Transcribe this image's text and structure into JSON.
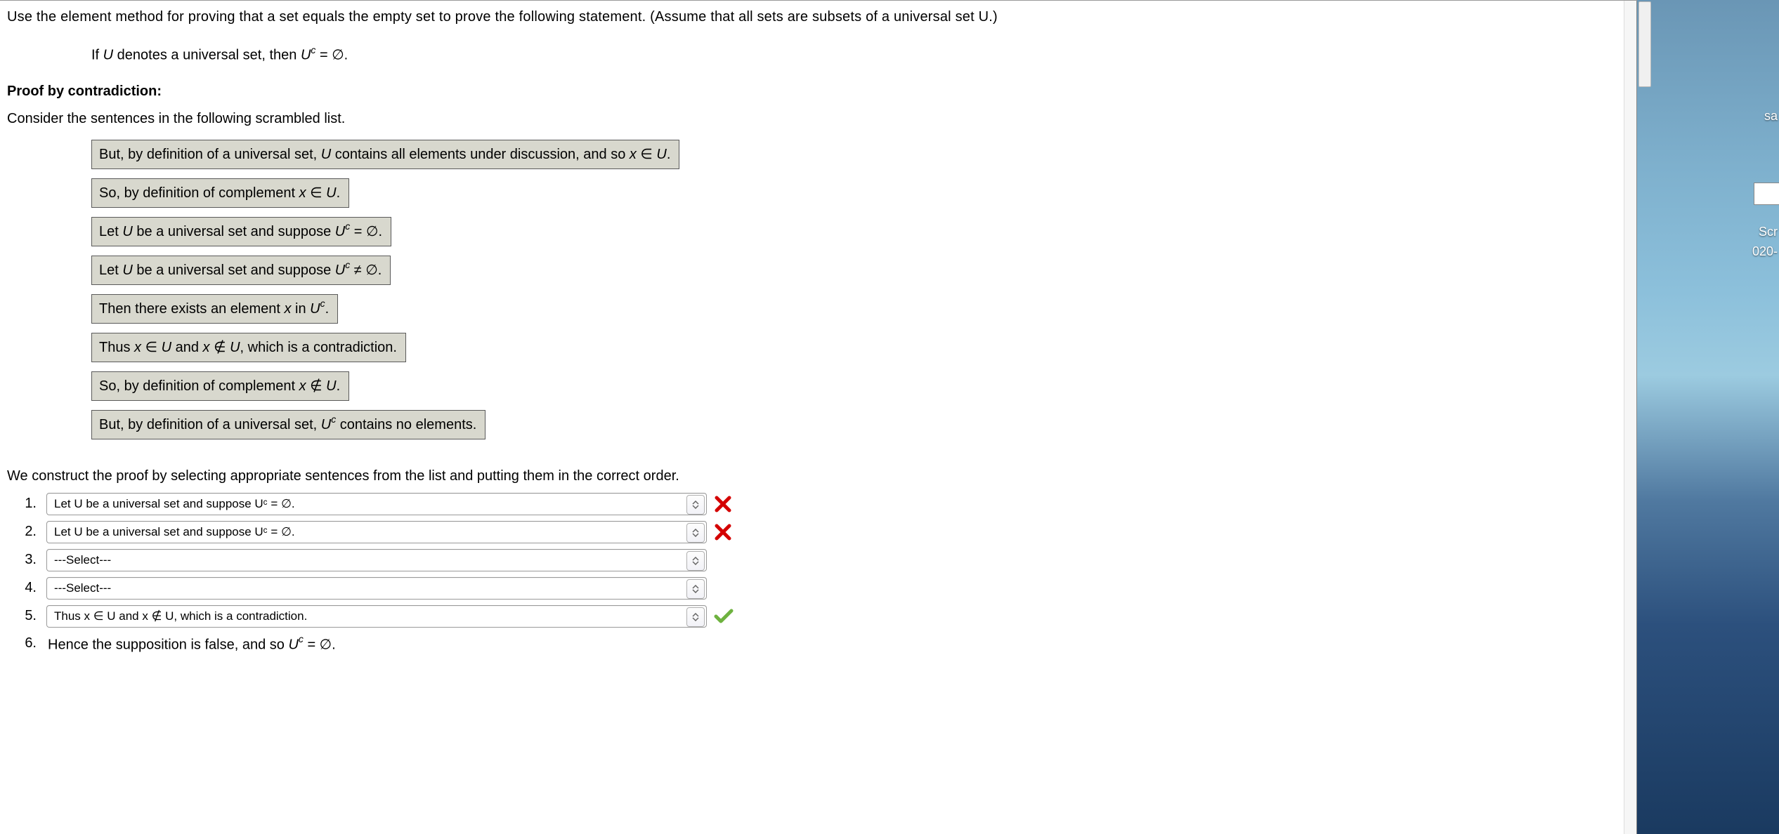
{
  "instruction": "Use the element method for proving that a set equals the empty set to prove the following statement. (Assume that all sets are subsets of a universal set U.)",
  "statement_prefix": "If ",
  "statement_U": "U",
  "statement_mid": " denotes a universal set, then ",
  "statement_Uc": "U",
  "statement_eq": " = ∅.",
  "proof_heading": "Proof by contradiction:",
  "scrambled_intro": "Consider the sentences in the following scrambled list.",
  "tiles": {
    "t1_a": "But, by definition of a universal set, ",
    "t1_b": "U",
    "t1_c": " contains all elements under discussion, and so ",
    "t1_d": "x",
    "t1_e": " ∈ ",
    "t1_f": "U",
    "t1_g": ".",
    "t2_a": "So, by definition of complement ",
    "t2_b": "x",
    "t2_c": " ∈ ",
    "t2_d": "U",
    "t2_e": ".",
    "t3_a": "Let ",
    "t3_b": "U",
    "t3_c": " be a universal set and suppose ",
    "t3_d": "U",
    "t3_e": " = ∅.",
    "t4_a": "Let ",
    "t4_b": "U",
    "t4_c": " be a universal set and suppose ",
    "t4_d": "U",
    "t4_e": " ≠ ∅.",
    "t5_a": "Then there exists an element ",
    "t5_b": "x",
    "t5_c": " in ",
    "t5_d": "U",
    "t5_e": ".",
    "t6_a": "Thus ",
    "t6_b": "x",
    "t6_c": " ∈ ",
    "t6_d": "U",
    "t6_e": " and ",
    "t6_f": "x",
    "t6_g": " ∉ ",
    "t6_h": "U",
    "t6_i": ", which is a contradiction.",
    "t7_a": "So, by definition of complement ",
    "t7_b": "x",
    "t7_c": " ∉ ",
    "t7_d": "U",
    "t7_e": ".",
    "t8_a": "But, by definition of a universal set, ",
    "t8_b": "U",
    "t8_c": " contains no elements."
  },
  "construct_sentence": "We construct the proof by selecting appropriate sentences from the list and putting them in the correct order.",
  "answers": {
    "nums": [
      "1.",
      "2.",
      "3.",
      "4.",
      "5.",
      "6."
    ],
    "row1": "Let U be a universal set and suppose Uᶜ = ∅.",
    "row2": "Let U be a universal set and suppose Uᶜ = ∅.",
    "row3": "---Select---",
    "row4": "---Select---",
    "row5": "Thus x ∈ U and x ∉ U, which is a contradiction.",
    "row6_a": "Hence the supposition is false, and so ",
    "row6_b": "U",
    "row6_c": " = ∅."
  },
  "sliver": {
    "sa": "sa",
    "scr": "Scr",
    "date": "020-"
  }
}
